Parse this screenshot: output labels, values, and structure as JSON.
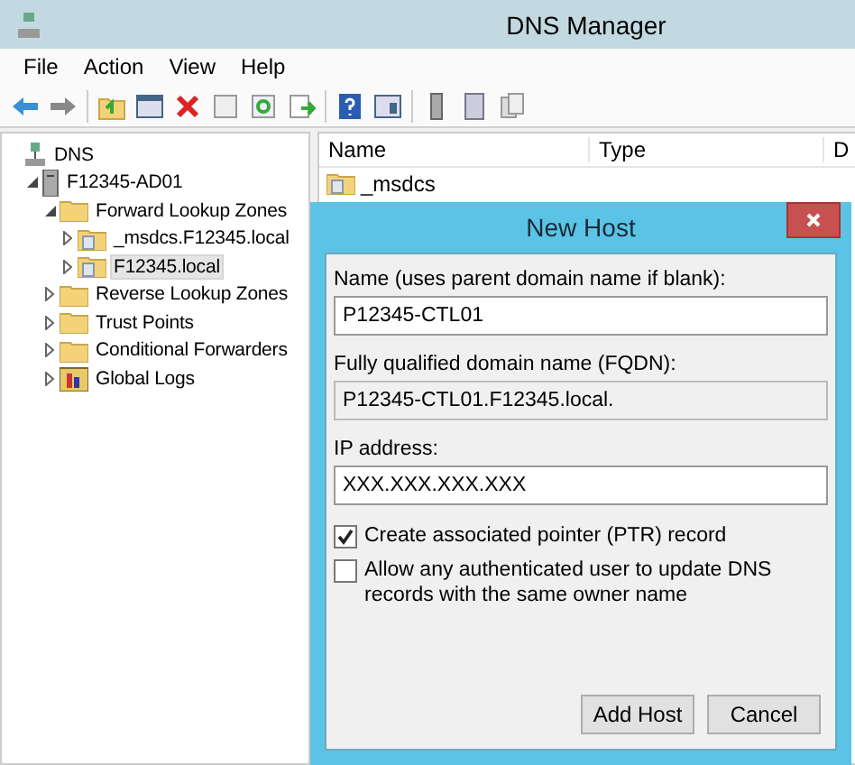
{
  "window": {
    "title": "DNS Manager"
  },
  "menu": [
    "File",
    "Action",
    "View",
    "Help"
  ],
  "tree": [
    {
      "label": "DNS",
      "kind": "dns",
      "selected": false,
      "children": [
        {
          "label": "F12345-AD01",
          "kind": "server",
          "expanded": true,
          "selected": false,
          "children": [
            {
              "label": "Forward Lookup Zones",
              "kind": "folder",
              "expanded": true,
              "selected": false,
              "children": [
                {
                  "label": "_msdcs.F12345.local",
                  "kind": "zone",
                  "expanded": false,
                  "selected": false
                },
                {
                  "label": "F12345.local",
                  "kind": "zone",
                  "expanded": false,
                  "selected": true
                }
              ]
            },
            {
              "label": "Reverse Lookup Zones",
              "kind": "folder",
              "expanded": false,
              "selected": false
            },
            {
              "label": "Trust Points",
              "kind": "folder",
              "expanded": false,
              "selected": false
            },
            {
              "label": "Conditional Forwarders",
              "kind": "folder",
              "expanded": false,
              "selected": false
            },
            {
              "label": "Global Logs",
              "kind": "logs",
              "expanded": false,
              "selected": false
            }
          ]
        }
      ]
    }
  ],
  "list": {
    "columns": [
      "Name",
      "Type",
      "D"
    ],
    "rows": [
      {
        "name": "_msdcs",
        "kind": "zone"
      }
    ]
  },
  "dialog": {
    "title": "New Host",
    "fields": [
      {
        "label": "Name (uses parent domain name if blank):",
        "value": "P12345-CTL01",
        "readonly": false
      },
      {
        "label": "Fully qualified domain name (FQDN):",
        "value": "P12345-CTL01.F12345.local.",
        "readonly": true
      },
      {
        "label": "IP address:",
        "value": "XXX.XXX.XXX.XXX",
        "readonly": false
      }
    ],
    "checkboxes": [
      {
        "label": "Create associated pointer (PTR) record",
        "checked": true
      },
      {
        "label": "Allow any authenticated user to update DNS records with the same owner name",
        "checked": false
      }
    ],
    "buttons": [
      "Add Host",
      "Cancel"
    ]
  }
}
